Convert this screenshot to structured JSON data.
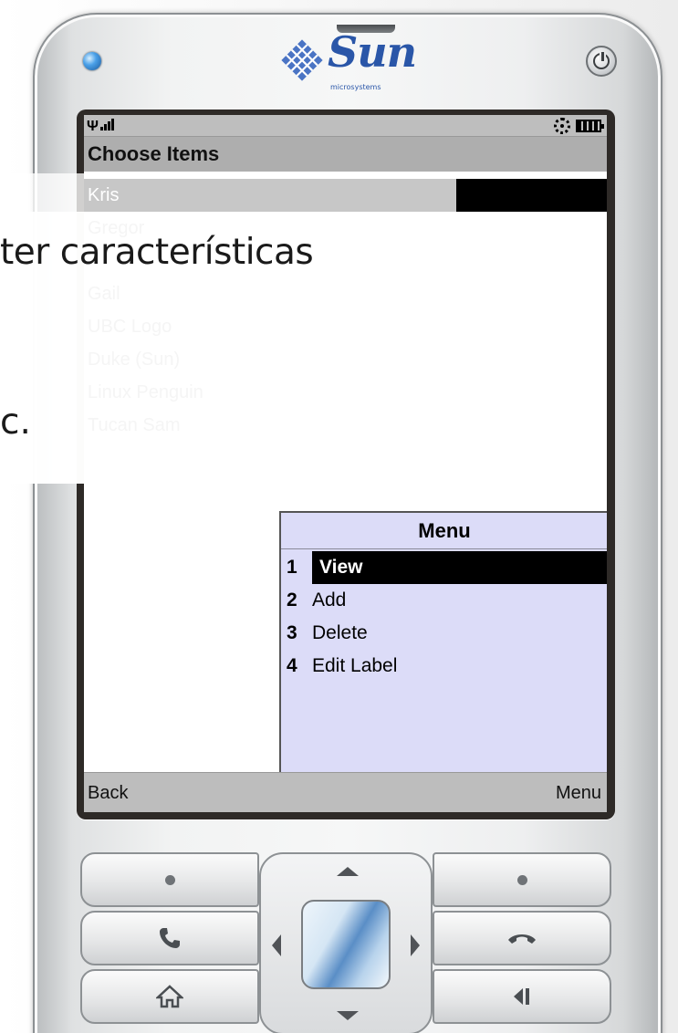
{
  "device": {
    "brand": "Sun",
    "brand_sub": "microsystems",
    "icons": [
      "led-indicator-icon",
      "power-icon",
      "sun-logo-icon"
    ]
  },
  "screen": {
    "title": "Choose Items",
    "items": [
      {
        "label": "Kris",
        "selected": true
      },
      {
        "label": "Gregor",
        "selected": false
      },
      {
        "label": "",
        "selected": false
      },
      {
        "label": "Gail",
        "selected": false
      },
      {
        "label": "UBC Logo",
        "selected": false
      },
      {
        "label": "Duke (Sun)",
        "selected": false
      },
      {
        "label": "Linux Penguin",
        "selected": false
      },
      {
        "label": "Tucan Sam",
        "selected": false
      }
    ],
    "softkeys": {
      "left": "Back",
      "right": "Menu"
    }
  },
  "menu": {
    "title": "Menu",
    "items": [
      {
        "num": "1",
        "label": "View",
        "active": true
      },
      {
        "num": "2",
        "label": "Add",
        "active": false
      },
      {
        "num": "3",
        "label": "Delete",
        "active": false
      },
      {
        "num": "4",
        "label": "Edit Label",
        "active": false
      }
    ]
  },
  "overlay": {
    "line1": "ter características",
    "line2": "c."
  },
  "keypad": {
    "icons": [
      "softkey-left-dot-icon",
      "softkey-right-dot-icon",
      "call-icon",
      "end-call-icon",
      "home-icon",
      "back-icon",
      "dpad-up-icon",
      "dpad-down-icon",
      "dpad-left-icon",
      "dpad-right-icon",
      "select-key-icon"
    ]
  },
  "colors": {
    "screen_bg": "#ffffff",
    "status_bar": "#bebebe",
    "title_bar": "#aeaeae",
    "menu_bg": "#dcdcf8",
    "selection": "#000000",
    "logo_blue": "#2a56a8"
  }
}
